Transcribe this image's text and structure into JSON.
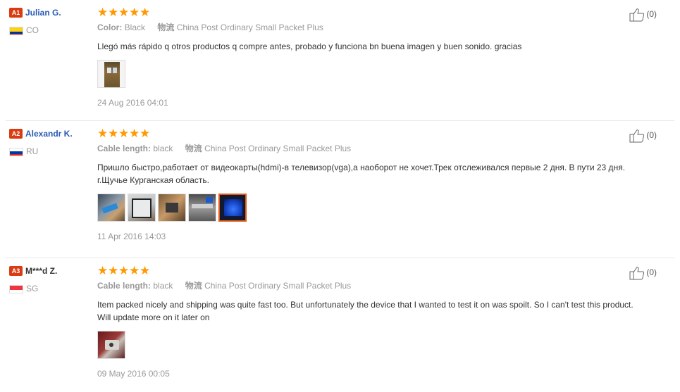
{
  "colors": {
    "badge": "#d93b12",
    "buyer_link": "#2a5bb4",
    "stars": "#ff9900",
    "muted": "#999999",
    "body_text": "#333333",
    "selected_thumb_border": "#e05a1a"
  },
  "reviews": [
    {
      "level": "A1",
      "buyer": "Julian G.",
      "country": "CO",
      "stars": 5,
      "attr1_key": "Color:",
      "attr1_value": "Black",
      "shipping_key": "物流",
      "shipping_value": "China Post Ordinary Small Packet Plus",
      "text": "Llegó más rápido q otros productos q compre antes, probado y funciona bn buena imagen y buen sonido. gracias",
      "photos": 1,
      "date": "24 Aug 2016 04:01",
      "helpful_count": "(0)"
    },
    {
      "level": "A2",
      "buyer": "Alexandr K.",
      "country": "RU",
      "stars": 5,
      "attr1_key": "Cable length:",
      "attr1_value": "black",
      "shipping_key": "物流",
      "shipping_value": "China Post Ordinary Small Packet Plus",
      "text": "Пришло быстро,работает от видеокарты(hdmi)-в телевизор(vga),а наоборот не хочет.Трек отслеживался первые 2 дня. В пути 23 дня. г.Щучье Курганская область.",
      "photos": 5,
      "date": "11 Apr 2016 14:03",
      "helpful_count": "(0)"
    },
    {
      "level": "A3",
      "buyer": "M***d Z.",
      "country": "SG",
      "stars": 5,
      "attr1_key": "Cable length:",
      "attr1_value": "black",
      "shipping_key": "物流",
      "shipping_value": "China Post Ordinary Small Packet Plus",
      "text": "Item packed nicely and shipping was quite fast too. But unfortunately the device that I wanted to test it on was spoilt. So I can't test this product. Will update more on it later on",
      "photos": 1,
      "date": "09 May 2016 00:05",
      "helpful_count": "(0)"
    }
  ]
}
